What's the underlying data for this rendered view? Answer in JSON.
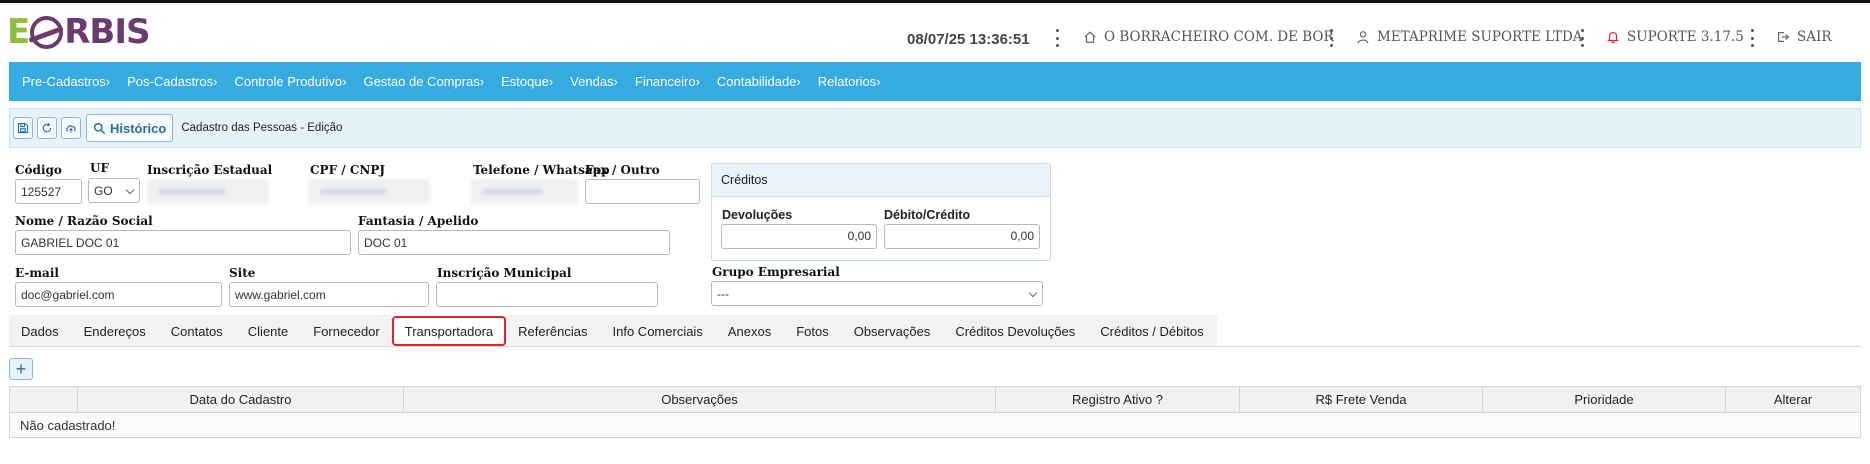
{
  "app": {
    "logo_e": "E",
    "logo_rest": "RBIS",
    "brand_green": "#8dbf3a",
    "brand_purple": "#6b3a6f"
  },
  "header": {
    "datetime": "08/07/25 13:36:51",
    "company": "O BORRACHEIRO COM. DE BOR",
    "user": "METAPRIME SUPORTE LTDA",
    "support": "SUPORTE 3.17.5",
    "logout": "SAIR"
  },
  "nav": {
    "color": "#36abe0",
    "items": [
      "Pre-Cadastros›",
      "Pos-Cadastros›",
      "Controle Produtivo›",
      "Gestao de Compras›",
      "Estoque›",
      "Vendas›",
      "Financeiro›",
      "Contabilidade›",
      "Relatorios›"
    ]
  },
  "toolbar": {
    "history_label": "Histórico",
    "title": "Cadastro das Pessoas - Edição"
  },
  "form": {
    "codigo_label": "Código",
    "codigo_value": "125527",
    "uf_label": "UF",
    "uf_value": "GO",
    "ie_label": "Inscrição Estadual",
    "cpf_label": "CPF / CNPJ",
    "telefone_label": "Telefone / Whatsapp",
    "fax_label": "Fax / Outro",
    "fax_value": "",
    "nome_label": "Nome / Razão Social",
    "nome_value": "GABRIEL DOC 01",
    "fantasia_label": "Fantasia / Apelido",
    "fantasia_value": "DOC 01",
    "email_label": "E-mail",
    "email_value": "doc@gabriel.com",
    "site_label": "Site",
    "site_value": "www.gabriel.com",
    "im_label": "Inscrição Municipal",
    "im_value": "",
    "grupo_label": "Grupo Empresarial",
    "grupo_value": "---"
  },
  "credits": {
    "title": "Créditos",
    "devolucoes_label": "Devoluções",
    "devolucoes_value": "0,00",
    "debito_label": "Débito/Crédito",
    "debito_value": "0,00"
  },
  "tabs": {
    "active_color": "#e0242a",
    "items": [
      "Dados",
      "Endereços",
      "Contatos",
      "Cliente",
      "Fornecedor",
      "Transportadora",
      "Referências",
      "Info Comerciais",
      "Anexos",
      "Fotos",
      "Observações",
      "Créditos Devoluções",
      "Créditos / Débitos"
    ]
  },
  "grid": {
    "add_label": "+",
    "columns": [
      "",
      "Data do Cadastro",
      "Observações",
      "Registro Ativo ?",
      "R$ Frete Venda",
      "Prioridade",
      "Alterar"
    ],
    "empty_message": "Não cadastrado!"
  }
}
